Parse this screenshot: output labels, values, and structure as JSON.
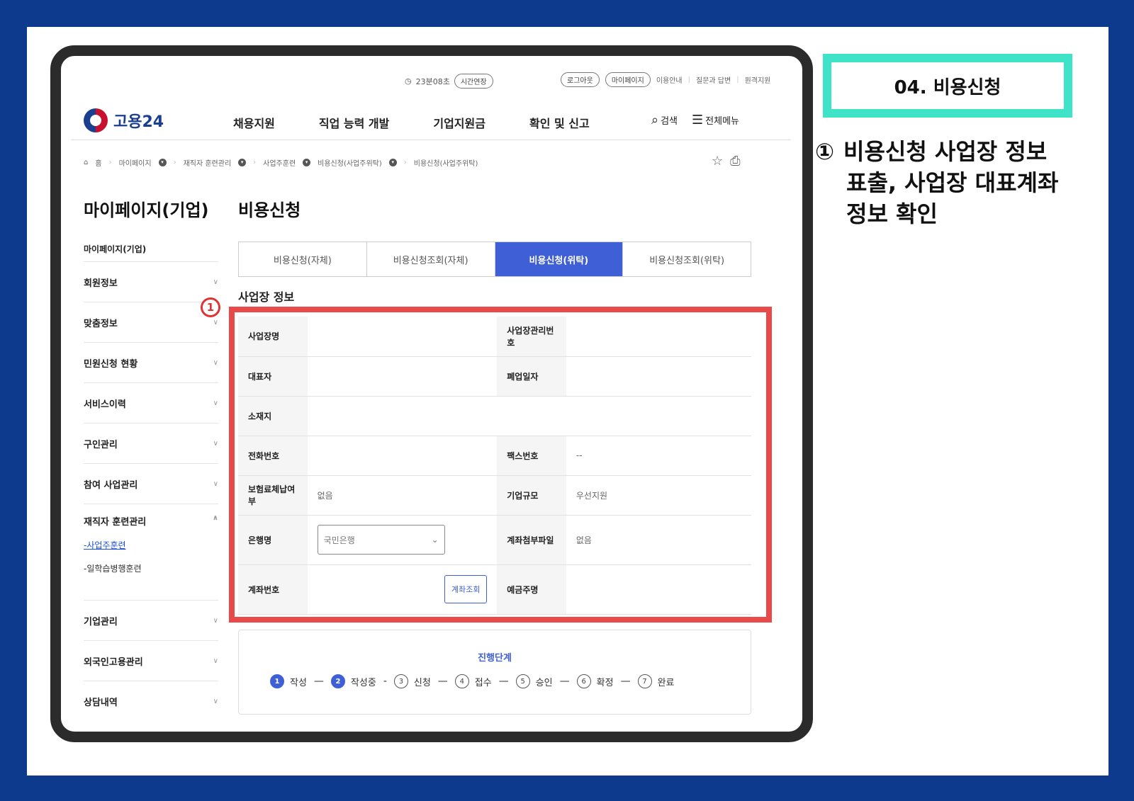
{
  "utility": {
    "timer": "23분08초",
    "extend": "시간연장",
    "logout": "로그아웃",
    "mypage": "마이페이지",
    "guide": "이용안내",
    "qna": "질문과 답변",
    "remote": "원격지원"
  },
  "header": {
    "logo_text": "고용24",
    "nav": [
      "채용지원",
      "직업 능력 개발",
      "기업지원금",
      "확인 및 신고"
    ],
    "search": "검색",
    "menu": "전체메뉴"
  },
  "breadcrumb": [
    "홈",
    "마이페이지",
    "재직자 훈련관리",
    "사업주훈련",
    "비용신청(사업주위탁)",
    "비용신청(사업주위탁)"
  ],
  "sidebar": {
    "title": "마이페이지(기업)",
    "subtitle": "마이페이지(기업)",
    "items_top": [
      "회원정보",
      "맞춤정보",
      "민원신청 현황",
      "서비스이력",
      "구인관리",
      "참여 사업관리"
    ],
    "open_item": "재직자 훈련관리",
    "open_subitems": [
      "-사업주훈련",
      "-일학습병행훈련"
    ],
    "items_bottom": [
      "기업관리",
      "외국인고용관리",
      "상담내역"
    ]
  },
  "main": {
    "title": "비용신청",
    "tabs": [
      "비용신청(자체)",
      "비용신청조회(자체)",
      "비용신청(위탁)",
      "비용신청조회(위탁)"
    ],
    "active_tab": 2,
    "section_title": "사업장 정보"
  },
  "info": {
    "biz_name_label": "사업장명",
    "biz_no_label": "사업장관리번호",
    "rep_label": "대표자",
    "closed_label": "폐업일자",
    "addr_label": "소재지",
    "phone_label": "전화번호",
    "fax_label": "팩스번호",
    "fax_value": "--",
    "arrears_label": "보험료체납여부",
    "arrears_value": "없음",
    "size_label": "기업규모",
    "size_value": "우선지원",
    "bank_label": "은행명",
    "bank_value": "국민은행",
    "attach_label": "계좌첨부파일",
    "attach_value": "없음",
    "account_label": "계좌번호",
    "account_button": "계좌조회",
    "holder_label": "예금주명"
  },
  "progress": {
    "title": "진행단계",
    "steps": [
      {
        "num": "1",
        "label": "작성",
        "done": true
      },
      {
        "num": "2",
        "label": "작성중",
        "done": true
      },
      {
        "num": "3",
        "label": "신청",
        "done": false
      },
      {
        "num": "4",
        "label": "접수",
        "done": false
      },
      {
        "num": "5",
        "label": "승인",
        "done": false
      },
      {
        "num": "6",
        "label": "확정",
        "done": false
      },
      {
        "num": "7",
        "label": "완료",
        "done": false
      }
    ]
  },
  "annotation": {
    "marker": "1",
    "step_title": "04. 비용신청",
    "bullet": "①",
    "note_lines": [
      "비용신청 사업장 정보",
      "표출, 사업장 대표계좌",
      "정보 확인"
    ]
  },
  "colors": {
    "background": "#0d3a8c",
    "accent": "#3f5fd6",
    "highlight": "#e84a4a",
    "teal": "#3ee3c8"
  }
}
